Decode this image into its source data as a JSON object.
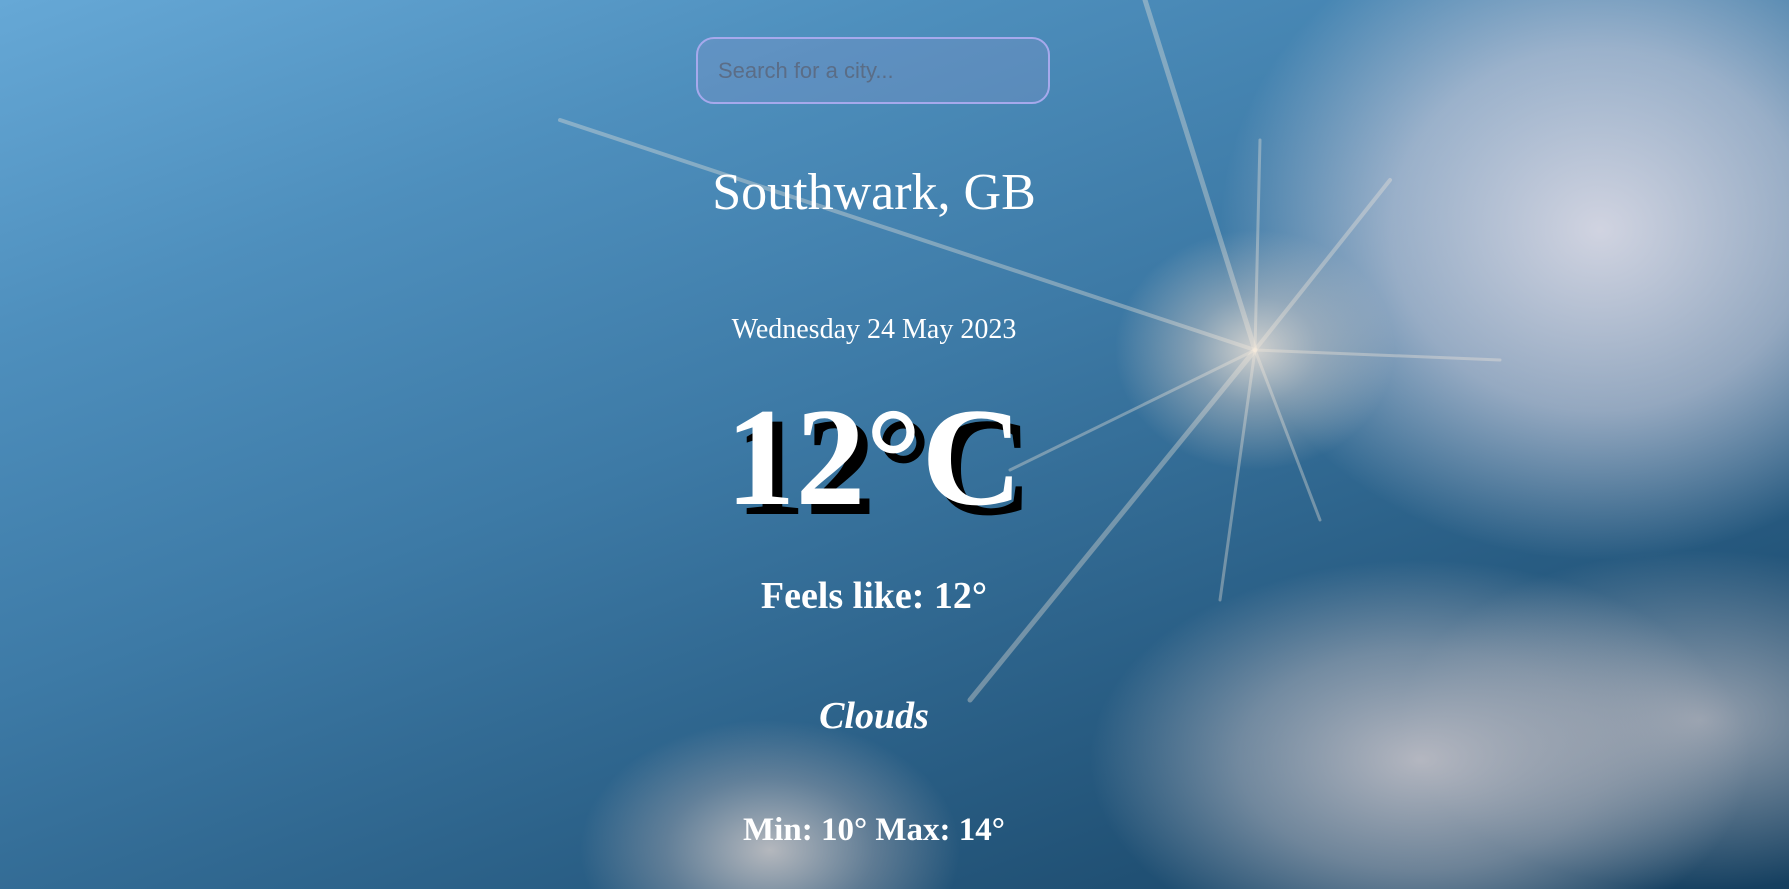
{
  "search": {
    "placeholder": "Search for a city...",
    "value": ""
  },
  "weather": {
    "location": "Southwark, GB",
    "date": "Wednesday 24 May 2023",
    "temperature": "12°C",
    "feels_like": "Feels like: 12°",
    "condition": "Clouds",
    "min_max": "Min: 10° Max: 14°"
  },
  "colors": {
    "text": "#ffffff",
    "search_border": "#a6a9ec",
    "temp_shadow": "#000000",
    "sky_top": "#66a8d6",
    "sky_bottom": "#153f5f"
  },
  "background": {
    "icon": "sky-with-sun-and-clouds"
  }
}
